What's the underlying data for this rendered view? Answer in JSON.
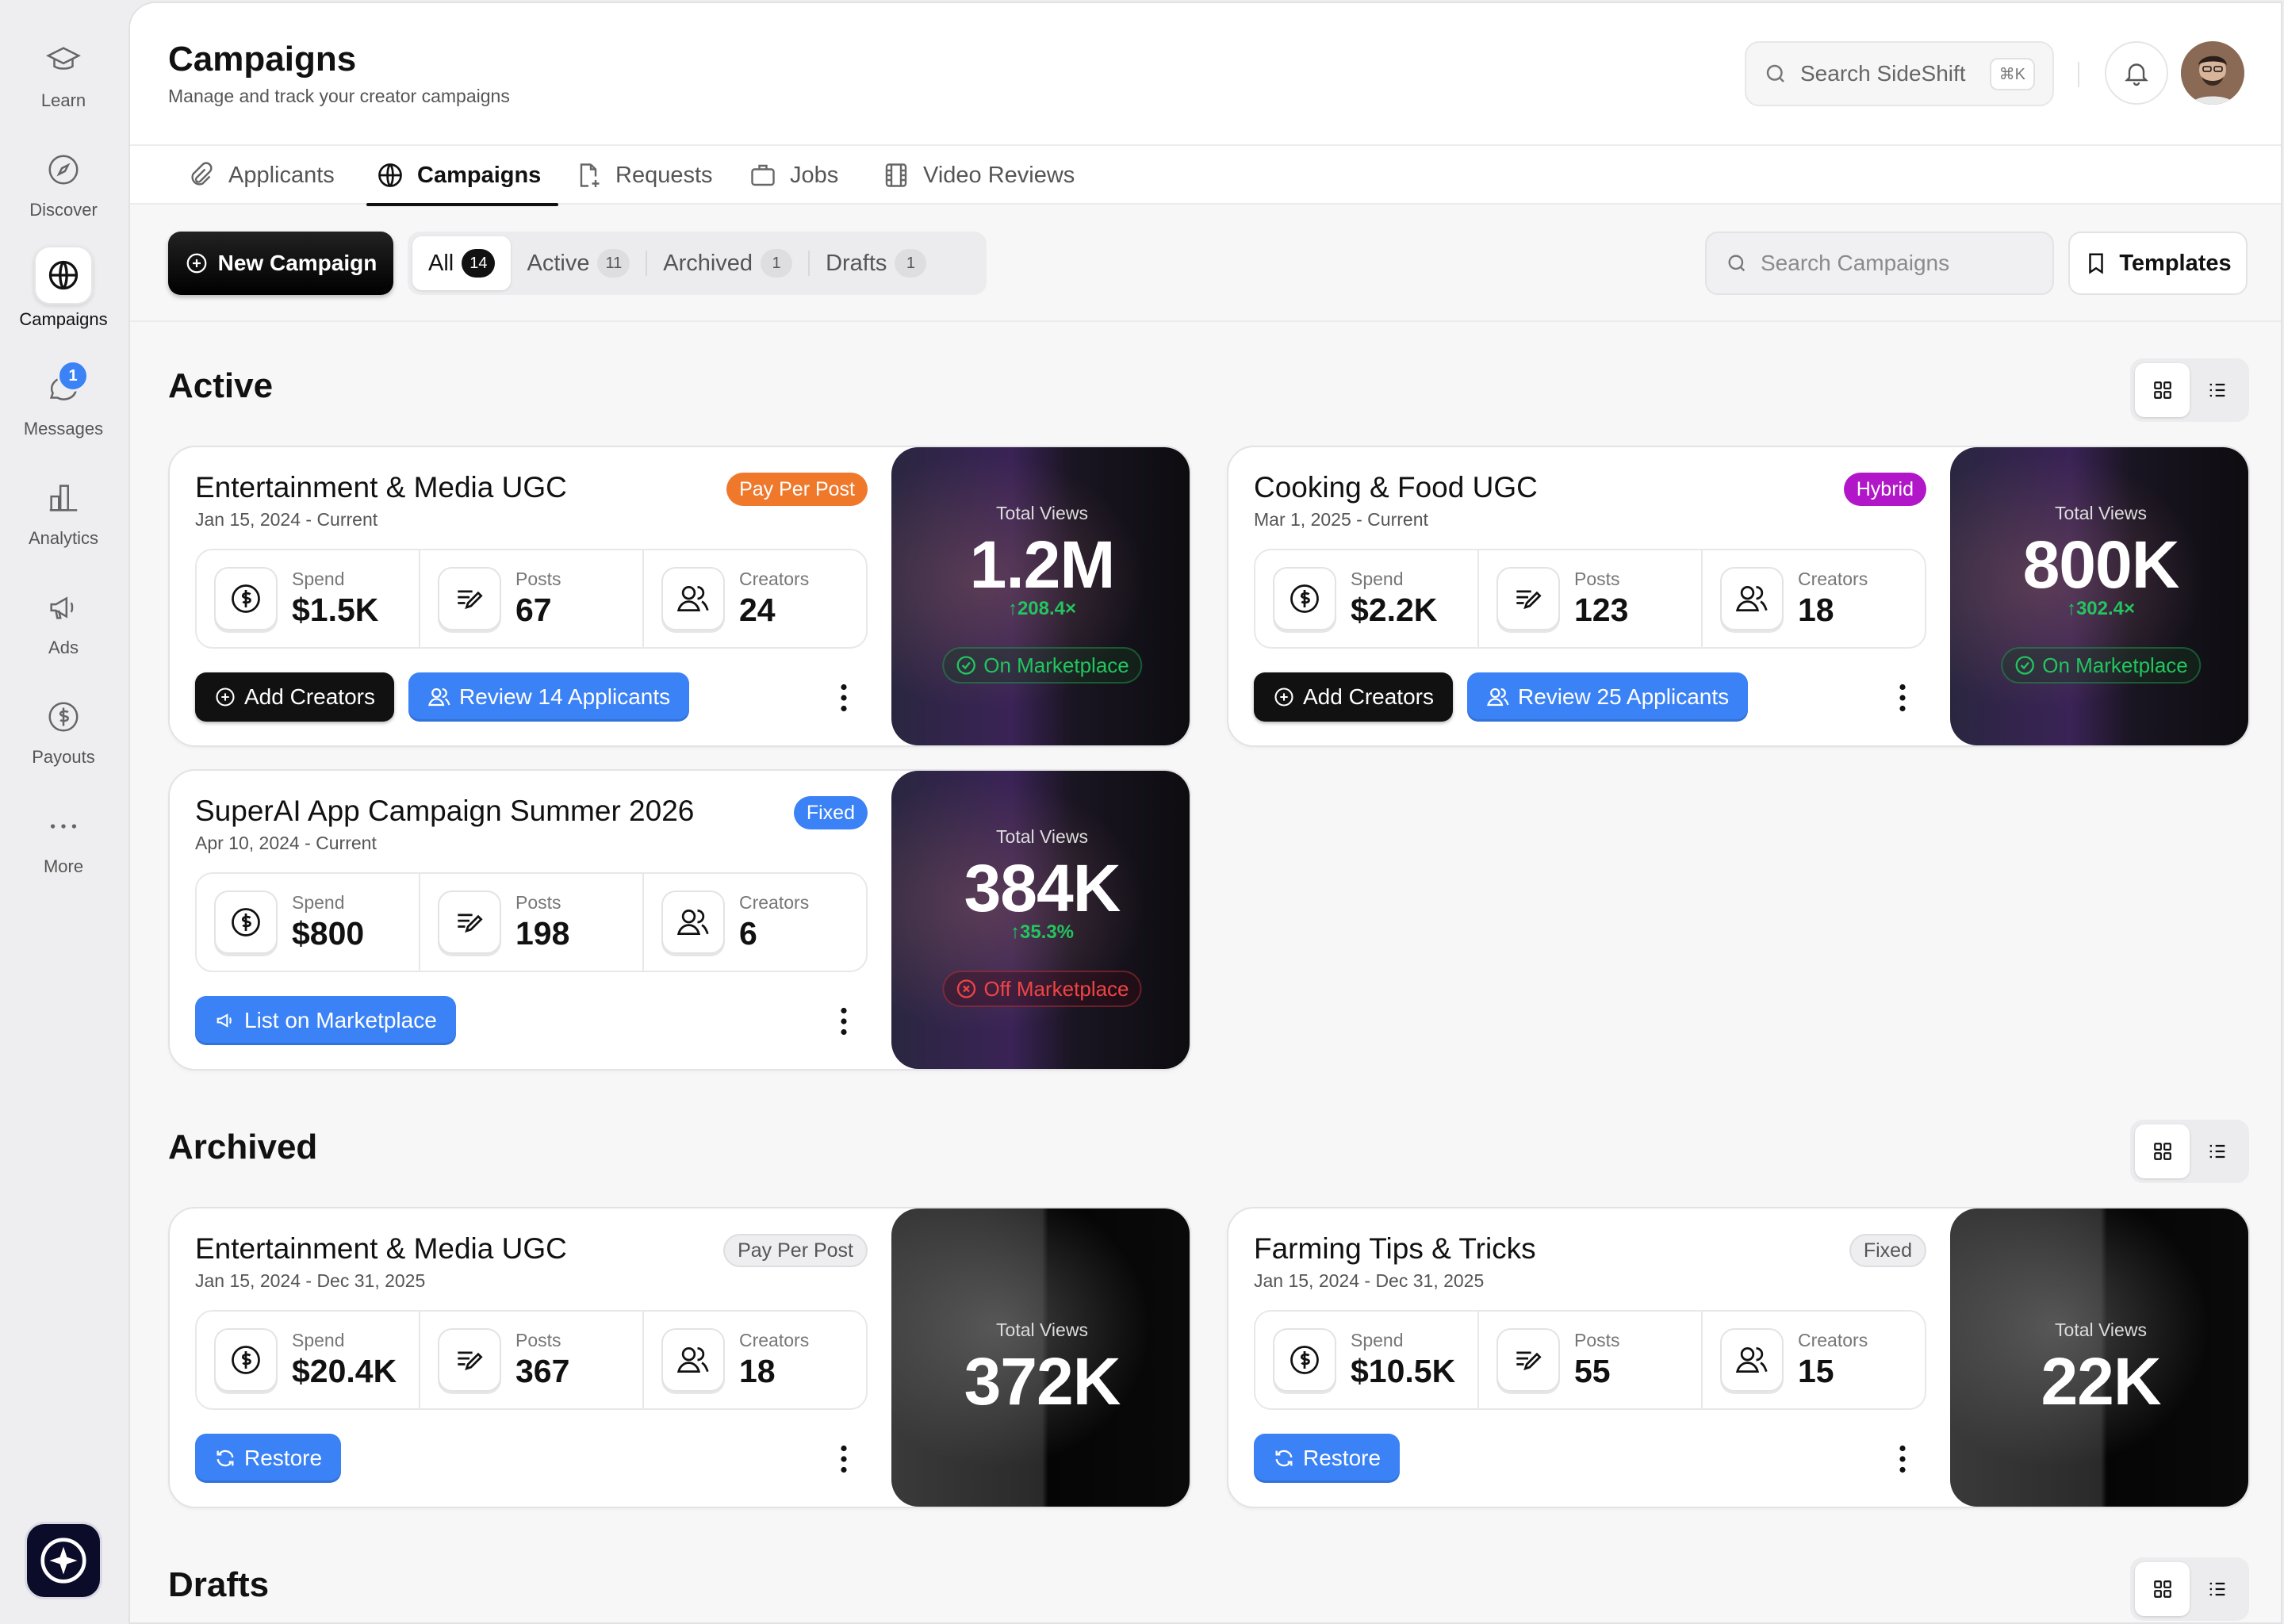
{
  "sidebar": {
    "items": [
      {
        "label": "Learn",
        "icon": "graduation-cap-icon"
      },
      {
        "label": "Discover",
        "icon": "compass-icon"
      },
      {
        "label": "Campaigns",
        "icon": "globe-icon"
      },
      {
        "label": "Messages",
        "icon": "chat-icon",
        "badge": "1"
      },
      {
        "label": "Analytics",
        "icon": "bar-chart-icon"
      },
      {
        "label": "Ads",
        "icon": "megaphone-icon"
      },
      {
        "label": "Payouts",
        "icon": "dollar-circle-icon"
      },
      {
        "label": "More",
        "icon": "more-dots-icon"
      }
    ]
  },
  "header": {
    "title": "Campaigns",
    "subtitle": "Manage and track your creator campaigns",
    "search_placeholder": "Search SideShift",
    "search_shortcut": "⌘K"
  },
  "tabs": [
    "Applicants",
    "Campaigns",
    "Requests",
    "Jobs",
    "Video Reviews"
  ],
  "toolbar": {
    "new_campaign": "New Campaign",
    "filters": [
      {
        "label": "All",
        "count": "14"
      },
      {
        "label": "Active",
        "count": "11"
      },
      {
        "label": "Archived",
        "count": "1"
      },
      {
        "label": "Drafts",
        "count": "1"
      }
    ],
    "search_placeholder": "Search Campaigns",
    "templates": "Templates"
  },
  "labels": {
    "spend": "Spend",
    "posts": "Posts",
    "creators": "Creators",
    "total_views": "Total Views"
  },
  "sections": {
    "active": {
      "title": "Active",
      "cards": [
        {
          "title": "Entertainment & Media UGC",
          "date": "Jan 15, 2024 - Current",
          "tag": "Pay Per Post",
          "spend": "$1.5K",
          "posts": "67",
          "creators": "24",
          "primary": "Add Creators",
          "secondary": "Review 14 Applicants",
          "views": "1.2M",
          "growth": "208.4×",
          "status": "On Marketplace"
        },
        {
          "title": "Cooking & Food UGC",
          "date": "Mar 1, 2025 - Current",
          "tag": "Hybrid",
          "spend": "$2.2K",
          "posts": "123",
          "creators": "18",
          "primary": "Add Creators",
          "secondary": "Review 25 Applicants",
          "views": "800K",
          "growth": "302.4×",
          "status": "On Marketplace"
        },
        {
          "title": "SuperAI App Campaign Summer 2026",
          "date": "Apr 10, 2024 - Current",
          "tag": "Fixed",
          "spend": "$800",
          "posts": "198",
          "creators": "6",
          "secondary": "List on Marketplace",
          "views": "384K",
          "growth": "35.3%",
          "status": "Off Marketplace"
        }
      ]
    },
    "archived": {
      "title": "Archived",
      "cards": [
        {
          "title": "Entertainment & Media UGC",
          "date": "Jan 15, 2024 - Dec 31, 2025",
          "tag": "Pay Per Post",
          "spend": "$20.4K",
          "posts": "367",
          "creators": "18",
          "secondary": "Restore",
          "views": "372K"
        },
        {
          "title": "Farming Tips & Tricks",
          "date": "Jan 15, 2024 - Dec 31, 2025",
          "tag": "Fixed",
          "spend": "$10.5K",
          "posts": "55",
          "creators": "15",
          "secondary": "Restore",
          "views": "22K"
        }
      ]
    },
    "drafts": {
      "title": "Drafts"
    }
  },
  "colors": {
    "accent": "#3b82f6",
    "positive": "#22c55e",
    "negative": "#ef4444",
    "tag_orange": "#f0782b",
    "tag_purple": "#b117c8"
  }
}
